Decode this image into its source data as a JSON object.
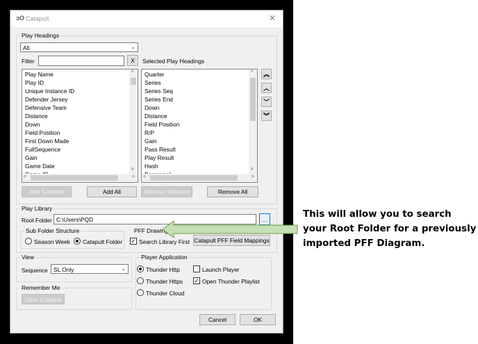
{
  "window": {
    "title": "Catapult",
    "app_icon": "catapult-logo-icon",
    "close_glyph": "✕"
  },
  "play_headings": {
    "group_title": "Play Headings",
    "combo_value": "All",
    "filter_label": "Filter",
    "filter_value": "",
    "clear_label": "X",
    "selected_label": "Selected Play Headings",
    "available_items": [
      "Play Name",
      "Play ID",
      "Unique Instance ID",
      "Defender Jersey",
      "Defensive Team",
      "Distance",
      "Down",
      "Field Position",
      "First Down Made",
      "FullSequence",
      "Gain",
      "Game Date",
      "Game ID"
    ],
    "selected_items": [
      "Quarter",
      "Series",
      "Series Seq",
      "Series End",
      "Down",
      "Distance",
      "Field Position",
      "R/P",
      "Gain",
      "Pass Result",
      "Play Result",
      "Hash",
      "Personnel"
    ],
    "add_selected": "Add Selected",
    "add_all": "Add All",
    "remove_selected": "Remove Selected",
    "remove_all": "Remove All",
    "move_top": "«",
    "move_up": "‹",
    "move_down": "›",
    "move_bottom": "»"
  },
  "play_library": {
    "group_title": "Play Library",
    "root_label": "Root Folder",
    "root_value": "C:\\Users\\PQD",
    "browse_label": "...",
    "subfolder_title": "Sub Folder Structure",
    "season_week": "Season Week",
    "catapult_folder": "Catapult Folder",
    "pff_title": "PFF Drawing",
    "search_library": "Search Library First",
    "field_mappings": "Catapult PFF Field Mappings"
  },
  "view": {
    "group_title": "View",
    "sequence_label": "Sequence",
    "sequence_value": "SL Only"
  },
  "remember": {
    "group_title": "Remember Me",
    "clear_label": "Clear Catapult"
  },
  "player": {
    "group_title": "Player Application",
    "thunder_http": "Thunder Http",
    "thunder_https": "Thunder Https",
    "thunder_cloud": "Thunder Cloud",
    "launch_player": "Launch Player",
    "open_playlist": "Open Thunder Playlist"
  },
  "footer": {
    "cancel": "Cancel",
    "ok": "OK"
  },
  "annotation": {
    "text": "This will allow you to search your Root Folder for a previously imported PFF Diagram.",
    "arrow_color": "#c5e0b4"
  }
}
